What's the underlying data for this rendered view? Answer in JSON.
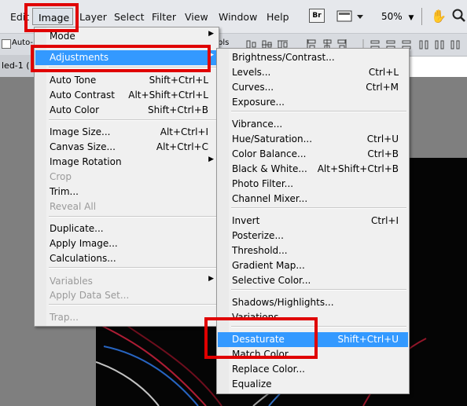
{
  "menubar": {
    "edit": "Edit",
    "image": "Image",
    "layer": "Layer",
    "select": "Select",
    "filter": "Filter",
    "view": "View",
    "window": "Window",
    "help": "Help",
    "bridge_badge": "Br",
    "zoom": "50%"
  },
  "options": {
    "auto_label": "Auto-",
    "pls_fragment": "pls"
  },
  "doc_tab": "led-1 (",
  "image_menu": [
    {
      "label": "Mode",
      "shortcut": "",
      "submenu": true,
      "disabled": false
    },
    {
      "label": "Adjustments",
      "shortcut": "",
      "submenu": true,
      "disabled": false,
      "highlighted": true
    },
    {
      "label": "Auto Tone",
      "shortcut": "Shift+Ctrl+L",
      "disabled": false
    },
    {
      "label": "Auto Contrast",
      "shortcut": "Alt+Shift+Ctrl+L",
      "disabled": false
    },
    {
      "label": "Auto Color",
      "shortcut": "Shift+Ctrl+B",
      "disabled": false
    },
    {
      "label": "Image Size...",
      "shortcut": "Alt+Ctrl+I",
      "disabled": false
    },
    {
      "label": "Canvas Size...",
      "shortcut": "Alt+Ctrl+C",
      "disabled": false
    },
    {
      "label": "Image Rotation",
      "shortcut": "",
      "submenu": true,
      "disabled": false
    },
    {
      "label": "Crop",
      "shortcut": "",
      "disabled": true
    },
    {
      "label": "Trim...",
      "shortcut": "",
      "disabled": false
    },
    {
      "label": "Reveal All",
      "shortcut": "",
      "disabled": true
    },
    {
      "label": "Duplicate...",
      "shortcut": "",
      "disabled": false
    },
    {
      "label": "Apply Image...",
      "shortcut": "",
      "disabled": false
    },
    {
      "label": "Calculations...",
      "shortcut": "",
      "disabled": false
    },
    {
      "label": "Variables",
      "shortcut": "",
      "submenu": true,
      "disabled": true
    },
    {
      "label": "Apply Data Set...",
      "shortcut": "",
      "disabled": true
    },
    {
      "label": "Trap...",
      "shortcut": "",
      "disabled": true
    }
  ],
  "adjustments_menu": [
    {
      "label": "Brightness/Contrast...",
      "shortcut": ""
    },
    {
      "label": "Levels...",
      "shortcut": "Ctrl+L"
    },
    {
      "label": "Curves...",
      "shortcut": "Ctrl+M"
    },
    {
      "label": "Exposure...",
      "shortcut": ""
    },
    {
      "label": "Vibrance...",
      "shortcut": ""
    },
    {
      "label": "Hue/Saturation...",
      "shortcut": "Ctrl+U"
    },
    {
      "label": "Color Balance...",
      "shortcut": "Ctrl+B"
    },
    {
      "label": "Black & White...",
      "shortcut": "Alt+Shift+Ctrl+B"
    },
    {
      "label": "Photo Filter...",
      "shortcut": ""
    },
    {
      "label": "Channel Mixer...",
      "shortcut": ""
    },
    {
      "label": "Invert",
      "shortcut": "Ctrl+I"
    },
    {
      "label": "Posterize...",
      "shortcut": ""
    },
    {
      "label": "Threshold...",
      "shortcut": ""
    },
    {
      "label": "Gradient Map...",
      "shortcut": ""
    },
    {
      "label": "Selective Color...",
      "shortcut": ""
    },
    {
      "label": "Shadows/Highlights...",
      "shortcut": ""
    },
    {
      "label": "Variations...",
      "shortcut": ""
    },
    {
      "label": "Desaturate",
      "shortcut": "Shift+Ctrl+U",
      "highlighted": true
    },
    {
      "label": "Match Color...",
      "shortcut": ""
    },
    {
      "label": "Replace Color...",
      "shortcut": ""
    },
    {
      "label": "Equalize",
      "shortcut": ""
    }
  ],
  "colors": {
    "highlight": "#3399ff",
    "annotation": "#e00000",
    "menu_bg": "#f0f0f0"
  }
}
